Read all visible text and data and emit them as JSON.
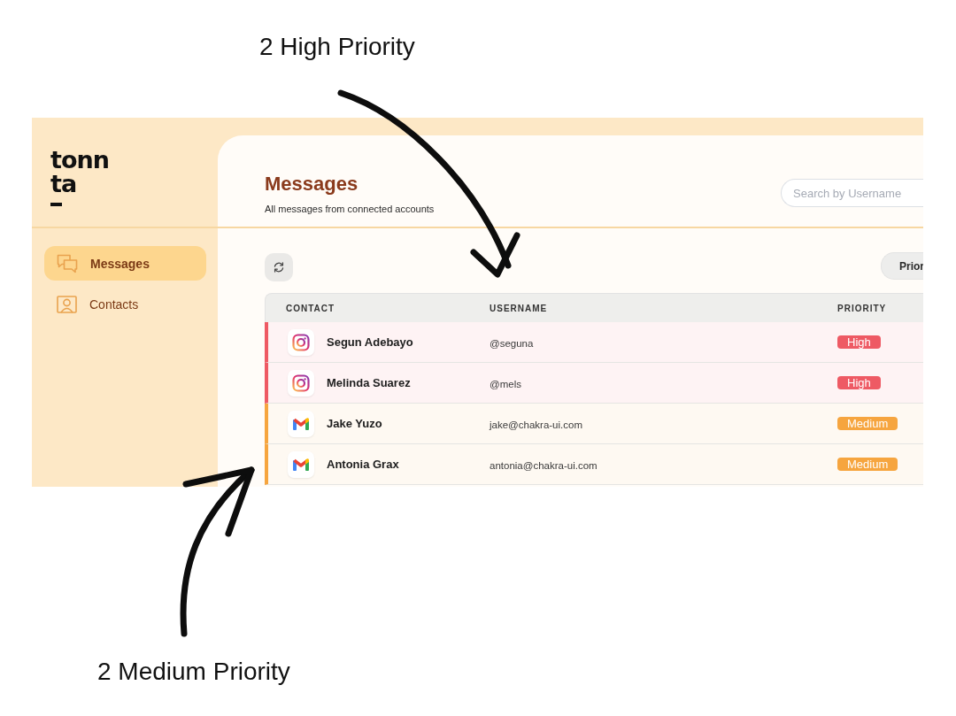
{
  "callouts": [
    {
      "text": "2 High Priority"
    },
    {
      "text": "2 Medium Priority"
    }
  ],
  "sidebar": {
    "logo": [
      "tonn",
      "ta"
    ],
    "items": [
      {
        "label": "Messages",
        "selected": true
      },
      {
        "label": "Contacts",
        "selected": false
      }
    ]
  },
  "header": {
    "title": "Messages",
    "subtitle": "All messages from connected accounts",
    "search": {
      "placeholder": "Search by Username"
    }
  },
  "toolbar": {
    "sort_button": "Prior"
  },
  "table": {
    "columns": [
      "CONTACT",
      "USERNAME",
      "PRIORITY"
    ],
    "rows": [
      {
        "kind": "camera",
        "contact": "Segun Adebayo",
        "username": "@seguna",
        "priority": "High",
        "color": "#ee5a64"
      },
      {
        "kind": "camera",
        "contact": "Melinda Suarez",
        "username": "@mels",
        "priority": "High",
        "color": "#ee5a64"
      },
      {
        "kind": "mail",
        "contact": "Jake Yuzo",
        "username": "jake@chakra-ui.com",
        "priority": "Medium",
        "color": "#f6a53f"
      },
      {
        "kind": "mail",
        "contact": "Antonia Grax",
        "username": "antonia@chakra-ui.com",
        "priority": "Medium",
        "color": "#f6a53f"
      }
    ]
  }
}
